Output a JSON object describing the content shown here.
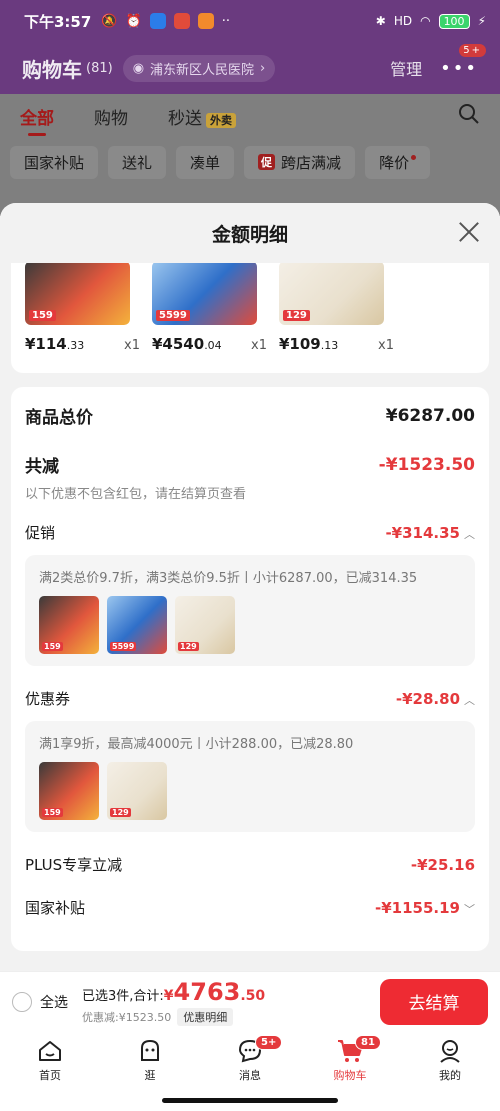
{
  "status_bar": {
    "time": "下午3:57",
    "battery": "100",
    "network": "HD"
  },
  "header": {
    "title": "购物车",
    "count": "(81)",
    "location": "浦东新区人民医院",
    "manage": "管理",
    "more_badge": "5+"
  },
  "tabs": [
    {
      "label": "全部",
      "active": true
    },
    {
      "label": "购物",
      "active": false
    },
    {
      "label": "秒送",
      "badge": "外卖",
      "active": false
    }
  ],
  "filters": [
    "国家补贴",
    "送礼",
    "凑单",
    "跨店满减",
    "降价"
  ],
  "filter_promo_tag": "促",
  "modal": {
    "title": "金额明细",
    "products": [
      {
        "thumb_label": "159",
        "price_int": "¥114",
        "price_dec": ".33",
        "qty": "x1",
        "color": "#e1573d"
      },
      {
        "thumb_label": "5599",
        "price_int": "¥4540",
        "price_dec": ".04",
        "qty": "x1",
        "color": "#2f6fc9"
      },
      {
        "thumb_label": "129",
        "price_int": "¥109",
        "price_dec": ".13",
        "qty": "x1",
        "color": "#d9c7a2"
      }
    ],
    "total_label": "商品总价",
    "total_value": "¥6287.00",
    "reduce_label": "共减",
    "reduce_value": "-¥1523.50",
    "reduce_note": "以下优惠不包含红包，请在结算页查看",
    "promo": {
      "label": "促销",
      "value": "-¥314.35",
      "desc": "满2类总价9.7折，满3类总价9.5折丨小计6287.00，已减314.35",
      "thumbs": [
        "159",
        "5599",
        "129"
      ]
    },
    "coupon": {
      "label": "优惠券",
      "value": "-¥28.80",
      "desc": "满1享9折，最高减4000元丨小计288.00，已减28.80",
      "thumbs": [
        "159",
        "129"
      ]
    },
    "plus": {
      "label": "PLUS专享立减",
      "value": "-¥25.16"
    },
    "subsidy": {
      "label": "国家补贴",
      "value": "-¥1155.19"
    }
  },
  "checkout": {
    "select_all": "全选",
    "selected_text": "已选3件,合计:",
    "currency": "¥",
    "total_int": "4763",
    "total_dec": ".50",
    "discount_text": "优惠减:¥1523.50",
    "detail_button": "优惠明细",
    "checkout_button": "去结算"
  },
  "bottom_nav": [
    {
      "label": "首页",
      "icon": "home-icon"
    },
    {
      "label": "逛",
      "icon": "browse-icon"
    },
    {
      "label": "消息",
      "icon": "message-icon",
      "badge": "5+"
    },
    {
      "label": "购物车",
      "icon": "cart-icon",
      "badge": "81",
      "active": true
    },
    {
      "label": "我的",
      "icon": "profile-icon"
    }
  ],
  "colors": {
    "accent": "#e4393c",
    "checkout": "#ee2b33",
    "header": "#6a3a7f"
  }
}
